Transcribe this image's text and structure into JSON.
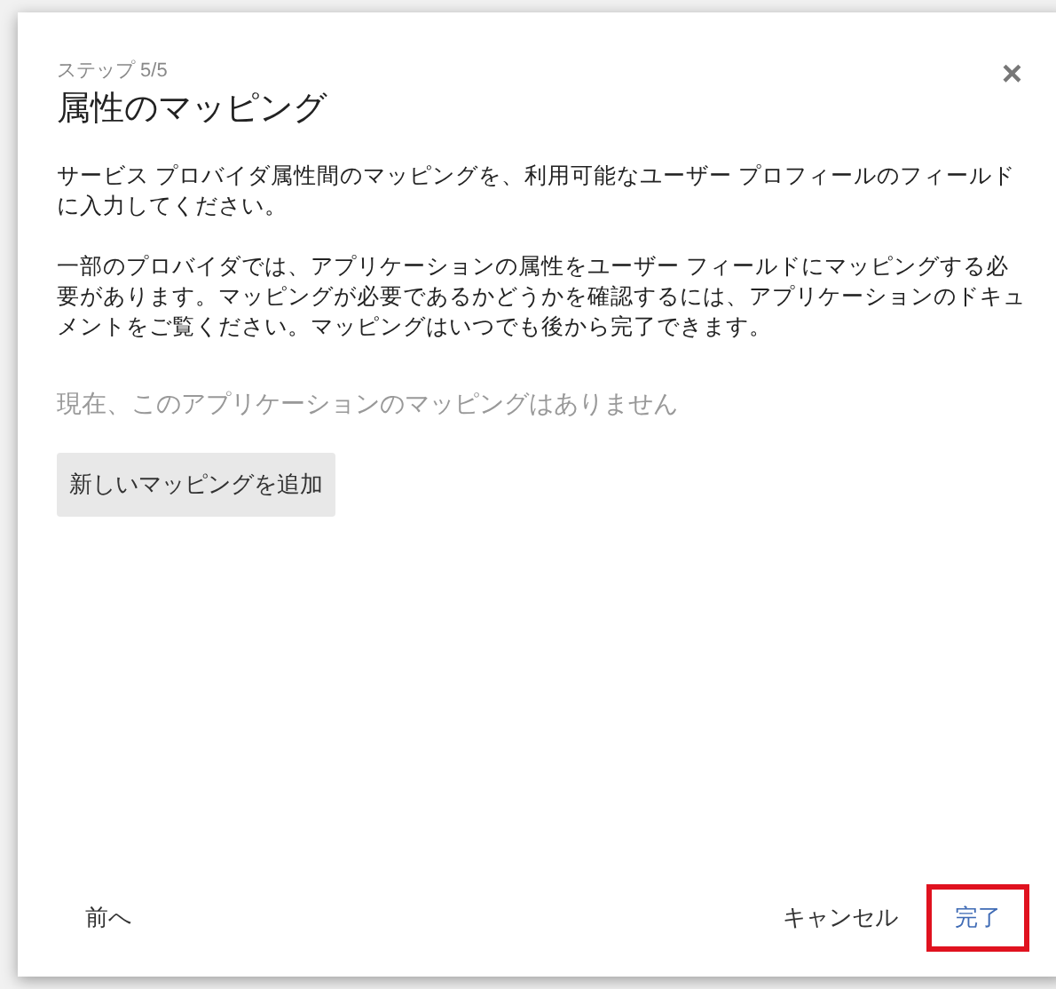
{
  "dialog": {
    "step": "ステップ 5/5",
    "title": "属性のマッピング",
    "close": "×",
    "paragraphs": [
      "サービス プロバイダ属性間のマッピングを、利用可能なユーザー プロフィールのフィールドに入力してください。",
      "一部のプロバイダでは、アプリケーションの属性をユーザー フィールドにマッピングする必要があります。マッピングが必要であるかどうかを確認するには、アプリケーションのドキュメントをご覧ください。マッピングはいつでも後から完了できます。"
    ],
    "empty_message": "現在、このアプリケーションのマッピングはありません",
    "add_button": "新しいマッピングを追加",
    "footer": {
      "back": "前へ",
      "cancel": "キャンセル",
      "done": {
        "label": "完了",
        "highlighted": true
      }
    }
  }
}
